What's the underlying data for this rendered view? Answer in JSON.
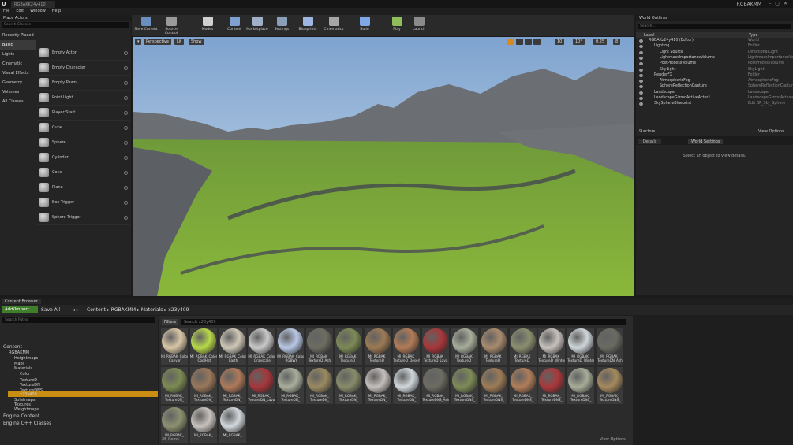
{
  "window": {
    "tab_title": "RGBAKK24y410",
    "user": "RGBAKMM",
    "logo": "U"
  },
  "menu": [
    "File",
    "Edit",
    "Window",
    "Help"
  ],
  "place_actors": {
    "title": "Place Actors",
    "search_placeholder": "Search Classes",
    "categories": [
      "Recently Placed",
      "Basic",
      "Lights",
      "Cinematic",
      "Visual Effects",
      "Geometry",
      "Volumes",
      "All Classes"
    ],
    "actors": [
      "Empty Actor",
      "Empty Character",
      "Empty Pawn",
      "Point Light",
      "Player Start",
      "Cube",
      "Sphere",
      "Cylinder",
      "Cone",
      "Plane",
      "Box Trigger",
      "Sphere Trigger"
    ]
  },
  "toolbar": [
    "Save Current",
    "Source Control",
    "Modes",
    "Content",
    "Marketplace",
    "Settings",
    "Blueprints",
    "Cinematics",
    "Build",
    "Play",
    "Launch"
  ],
  "viewport": {
    "perspective": "Perspective",
    "lit": "Lit",
    "show": "Show",
    "grid": "10",
    "angle": "10°",
    "scale": "0.25",
    "speed": "8"
  },
  "outliner": {
    "title": "World Outliner",
    "search_placeholder": "Search...",
    "col_label": "Label",
    "col_type": "Type",
    "rows": [
      {
        "label": "RGBAKz24y410 (Editor)",
        "type": "World",
        "indent": 0
      },
      {
        "label": "Lighting",
        "type": "Folder",
        "indent": 1
      },
      {
        "label": "Light Source",
        "type": "DirectionalLight",
        "indent": 2
      },
      {
        "label": "LightmassImportanceVolume",
        "type": "LightmassImportanceVol",
        "indent": 2
      },
      {
        "label": "PostProcessVolume",
        "type": "PostProcessVolume",
        "indent": 2
      },
      {
        "label": "SkyLight",
        "type": "SkyLight",
        "indent": 2
      },
      {
        "label": "RenderFX",
        "type": "Folder",
        "indent": 1
      },
      {
        "label": "AtmosphericFog",
        "type": "AtmosphericFog",
        "indent": 2
      },
      {
        "label": "SphereReflectionCapture",
        "type": "SphereReflectionCapture",
        "indent": 2
      },
      {
        "label": "Landscape",
        "type": "Landscape",
        "indent": 1
      },
      {
        "label": "LandscapeGizmoActiveActor1",
        "type": "LandscapeGizmoActiveA",
        "indent": 1
      },
      {
        "label": "SkySphereBlueprint",
        "type": "Edit BP_Sky_Sphere",
        "indent": 1
      }
    ],
    "count": "9 actors",
    "view_options": "View Options"
  },
  "details": {
    "tab_details": "Details",
    "tab_world": "World Settings",
    "empty_msg": "Select an object to view details."
  },
  "content_browser": {
    "tab": "Content Browser",
    "add_import": "Add/Import",
    "save_all": "Save All",
    "breadcrumbs": [
      "Content",
      "RGBAKMM",
      "Materials",
      "x23y409"
    ],
    "search_paths": "Search Paths",
    "filters": "Filters",
    "search_placeholder": "Search x23y409",
    "tree": [
      {
        "label": "Content",
        "indent": 0
      },
      {
        "label": "RGBAKMM",
        "indent": 1
      },
      {
        "label": "Heightmaps",
        "indent": 2
      },
      {
        "label": "Maps",
        "indent": 2
      },
      {
        "label": "Materials",
        "indent": 2
      },
      {
        "label": "Color",
        "indent": 3
      },
      {
        "label": "TextureD",
        "indent": 3
      },
      {
        "label": "TextureDN",
        "indent": 3
      },
      {
        "label": "TextureDNS",
        "indent": 3
      },
      {
        "label": "x23y409",
        "indent": 3
      },
      {
        "label": "Splatmaps",
        "indent": 2
      },
      {
        "label": "Textures",
        "indent": 2
      },
      {
        "label": "Weightmaps",
        "indent": 2
      },
      {
        "label": "Engine Content",
        "indent": 0
      },
      {
        "label": "Engine C++ Classes",
        "indent": 0
      }
    ],
    "assets": [
      {
        "l1": "MI_RGBAK_Color",
        "l2": "_Canyon",
        "c": "#d9c7a6"
      },
      {
        "l1": "MI_RGBAK_Color",
        "l2": "_CoolHot",
        "c": "#b8d84a"
      },
      {
        "l1": "MI_RGBAK_Color",
        "l2": "_Earth",
        "c": "#cfc8b8"
      },
      {
        "l1": "MI_RGBAK_Color",
        "l2": "_Grayscale",
        "c": "#c9c9c9"
      },
      {
        "l1": "MI_RGBAK_Color",
        "l2": "_RGBWY",
        "c": "#b9c8e6"
      },
      {
        "l1": "MI_RGBAK_",
        "l2": "TextureD_Ash",
        "c": "#6d6d62"
      },
      {
        "l1": "MI_RGBAK_",
        "l2": "TextureD_",
        "c": "#7d8a55"
      },
      {
        "l1": "MI_RGBAK_",
        "l2": "TextureD_",
        "c": "#9c7a55"
      },
      {
        "l1": "MI_RGBAK_",
        "l2": "TextureD_Desert",
        "c": "#b27b57"
      },
      {
        "l1": "MI_RGBAK_",
        "l2": "TextureD_Lava",
        "c": "#a8373a"
      },
      {
        "l1": "MI_RGBAK_",
        "l2": "TextureD_",
        "c": "#a7ad9a"
      },
      {
        "l1": "MI_RGBAK_",
        "l2": "TextureD_",
        "c": "#a98b6d"
      },
      {
        "l1": "MI_RGBAK_",
        "l2": "TextureD_",
        "c": "#8b8f6e"
      },
      {
        "l1": "MI_RGBAK_",
        "l2": "TextureD_Winter",
        "c": "#c7c1bd"
      },
      {
        "l1": "MI_RGBAK_",
        "l2": "TextureD_Winter",
        "c": "#cfd6da"
      },
      {
        "l1": "MI_RGBAK_",
        "l2": "TextureDN_Ash",
        "c": "#6a6a62"
      },
      {
        "l1": "MI_RGBAK_",
        "l2": "TextureDN_",
        "c": "#7c8a52"
      },
      {
        "l1": "MI_RGBAK_",
        "l2": "TextureDN_",
        "c": "#99775a"
      },
      {
        "l1": "MI_RGBAK_",
        "l2": "TextureDN_",
        "c": "#ae7a5a"
      },
      {
        "l1": "MI_RGBAK_",
        "l2": "TextureDN_Lava",
        "c": "#a5373b"
      },
      {
        "l1": "MI_RGBAK_",
        "l2": "TextureDN_",
        "c": "#a8ae9b"
      },
      {
        "l1": "MI_RGBAK_",
        "l2": "TextureDN_",
        "c": "#9a8a62"
      },
      {
        "l1": "MI_RGBAK_",
        "l2": "TextureDN_",
        "c": "#888c6a"
      },
      {
        "l1": "MI_RGBAK_",
        "l2": "TextureDN_",
        "c": "#c4bfbc"
      },
      {
        "l1": "MI_RGBAK_",
        "l2": "TextureDN_",
        "c": "#d0d7db"
      },
      {
        "l1": "MI_RGBAK_",
        "l2": "TextureDNS_Ash",
        "c": "#6c6c63"
      },
      {
        "l1": "MI_RGBAK_",
        "l2": "TextureDNS_",
        "c": "#7e8b56"
      },
      {
        "l1": "MI_RGBAK_",
        "l2": "TextureDNS_",
        "c": "#9d7b56"
      },
      {
        "l1": "MI_RGBAK_",
        "l2": "TextureDNS_",
        "c": "#b07d59"
      },
      {
        "l1": "MI_RGBAK_",
        "l2": "TextureDNS_",
        "c": "#a9393c"
      },
      {
        "l1": "MI_RGBAK_",
        "l2": "TextureDNS_",
        "c": "#a6ac98"
      },
      {
        "l1": "MI_RGBAK_",
        "l2": "TextureDNS_",
        "c": "#a5895e"
      },
      {
        "l1": "MI_RGBAK_",
        "l2": "",
        "c": "#8d9170"
      },
      {
        "l1": "MI_RGBAK_",
        "l2": "",
        "c": "#c8c2be"
      },
      {
        "l1": "MI_RGBAK_",
        "l2": "",
        "c": "#d2d8dc"
      }
    ],
    "count": "35 items",
    "view_options": "View Options"
  }
}
